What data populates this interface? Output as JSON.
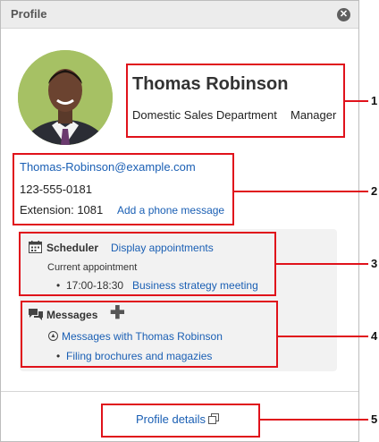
{
  "dialog": {
    "title": "Profile",
    "close_icon": "close-icon",
    "close_glyph": "✕"
  },
  "profile": {
    "name": "Thomas Robinson",
    "department": "Domestic Sales Department",
    "role": "Manager"
  },
  "contact": {
    "email": "Thomas-Robinson@example.com",
    "phone": "123-555-0181",
    "extension": "Extension: 1081",
    "phone_message_link": "Add a phone message"
  },
  "scheduler": {
    "icon": "calendar-icon",
    "title": "Scheduler",
    "display_link": "Display appointments",
    "current_label": "Current appointment",
    "bullet": "•",
    "appointment_time": "17:00-18:30",
    "appointment_title": "Business strategy meeting"
  },
  "messages": {
    "icon": "messages-icon",
    "title": "Messages",
    "add_glyph": "✚",
    "collapse_glyph": "▲",
    "thread_link": "Messages with Thomas Robinson",
    "bullet": "•",
    "items": [
      "Filing brochures and magazies"
    ]
  },
  "footer": {
    "details_link": "Profile details",
    "external_icon": "external-window-icon"
  },
  "callouts": [
    "1",
    "2",
    "3",
    "4",
    "5"
  ],
  "colors": {
    "accent_link": "#1a5fb4",
    "callout_red": "#e0121b",
    "title_bar": "#ececec",
    "panel_gray": "#f2f2f2"
  }
}
